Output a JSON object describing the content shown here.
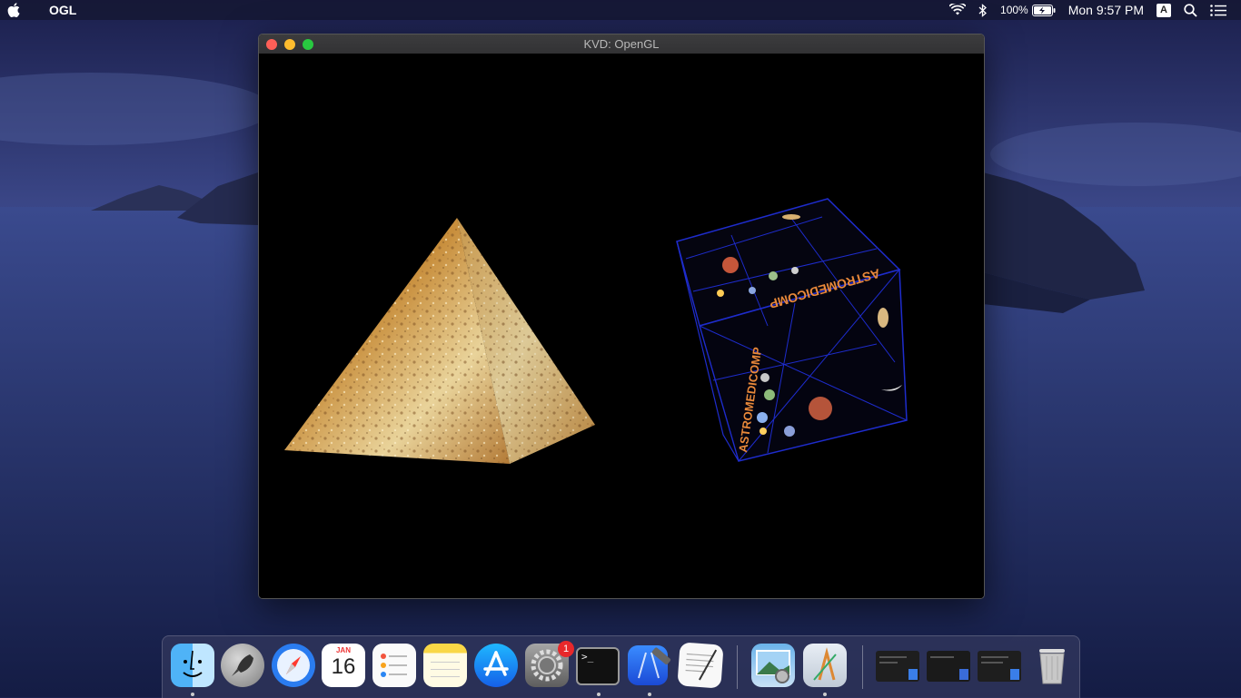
{
  "menubar": {
    "app_name": "OGL",
    "battery": "100%",
    "clock": "Mon 9:57 PM",
    "input_source": "A"
  },
  "window": {
    "title": "KVD: OpenGL"
  },
  "scene": {
    "cube_face_texts": [
      "ASTROMEDICOMP",
      "ASTROMEDICOMP"
    ]
  },
  "dock": {
    "calendar_month": "JAN",
    "calendar_day": "16",
    "system_prefs_badge": "1",
    "terminal_prompt": ">_"
  },
  "colors": {
    "menubar_bg": "#161834",
    "window_bg": "#000000",
    "close": "#fe5f57",
    "minimize": "#febc2e",
    "maximize": "#28c840",
    "cube_lines": "#1e2ccc",
    "cube_text": "#e8883a"
  }
}
